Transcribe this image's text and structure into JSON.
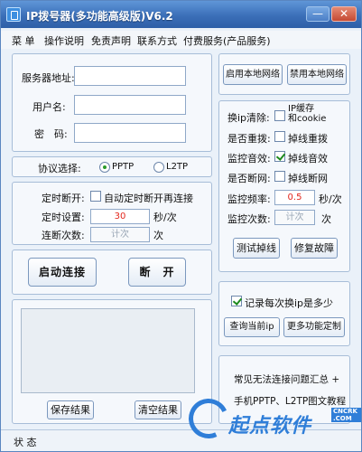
{
  "window": {
    "title": "IP拨号器(多功能高级版)V6.2",
    "min_glyph": "—",
    "close_glyph": "✕"
  },
  "menu": [
    "菜 单",
    "操作说明",
    "免责声明",
    "联系方式",
    "付费服务(产品服务)"
  ],
  "login": {
    "server_label": "服务器地址:",
    "user_label": "用户名:",
    "password_label": "密　码:",
    "server_value": "",
    "user_value": "",
    "password_value": ""
  },
  "protocol": {
    "label": "协议选择:",
    "options": [
      {
        "label": "PPTP",
        "selected": true
      },
      {
        "label": "L2TP",
        "selected": false
      }
    ]
  },
  "timer": {
    "disconnect_label": "定时断开:",
    "auto_reconnect_label": "自动定时断开再连接",
    "auto_reconnect_checked": false,
    "interval_label": "定时设置:",
    "interval_value": "30",
    "interval_unit": "秒/次",
    "count_label": "连断次数:",
    "count_placeholder": "计次",
    "count_unit": "次"
  },
  "actions": {
    "start_label": "启动连接",
    "stop_label": "断　开"
  },
  "log": {
    "save_label": "保存结果",
    "clear_label": "清空结果"
  },
  "network": {
    "enable_label": "启用本地网络",
    "disable_label": "禁用本地网络"
  },
  "monitor": {
    "clear_label": "换ip清除:",
    "clear_option": "IP缓存\n和cookie",
    "clear_checked": false,
    "redial_label": "是否重拨:",
    "redial_option": "掉线重拨",
    "redial_checked": false,
    "sound_label": "监控音效:",
    "sound_option": "掉线音效",
    "sound_checked": true,
    "cut_label": "是否断网:",
    "cut_option": "掉线断网",
    "cut_checked": false,
    "freq_label": "监控频率:",
    "freq_value": "0.5",
    "freq_unit": "秒/次",
    "count_label": "监控次数:",
    "count_placeholder": "计次",
    "count_unit": "次",
    "test_label": "测试掉线",
    "repair_label": "修复故障"
  },
  "iplog": {
    "record_label": "记录每次换ip是多少",
    "record_checked": true,
    "query_label": "查询当前ip",
    "more_label": "更多功能定制"
  },
  "help": {
    "line1": "常见无法连接问题汇总 +",
    "line2": "手机PPTP、L2TP图文教程"
  },
  "status": {
    "label": "状 态"
  },
  "watermark": {
    "text": "起点软件",
    "sub": "CNCRK .COM"
  }
}
